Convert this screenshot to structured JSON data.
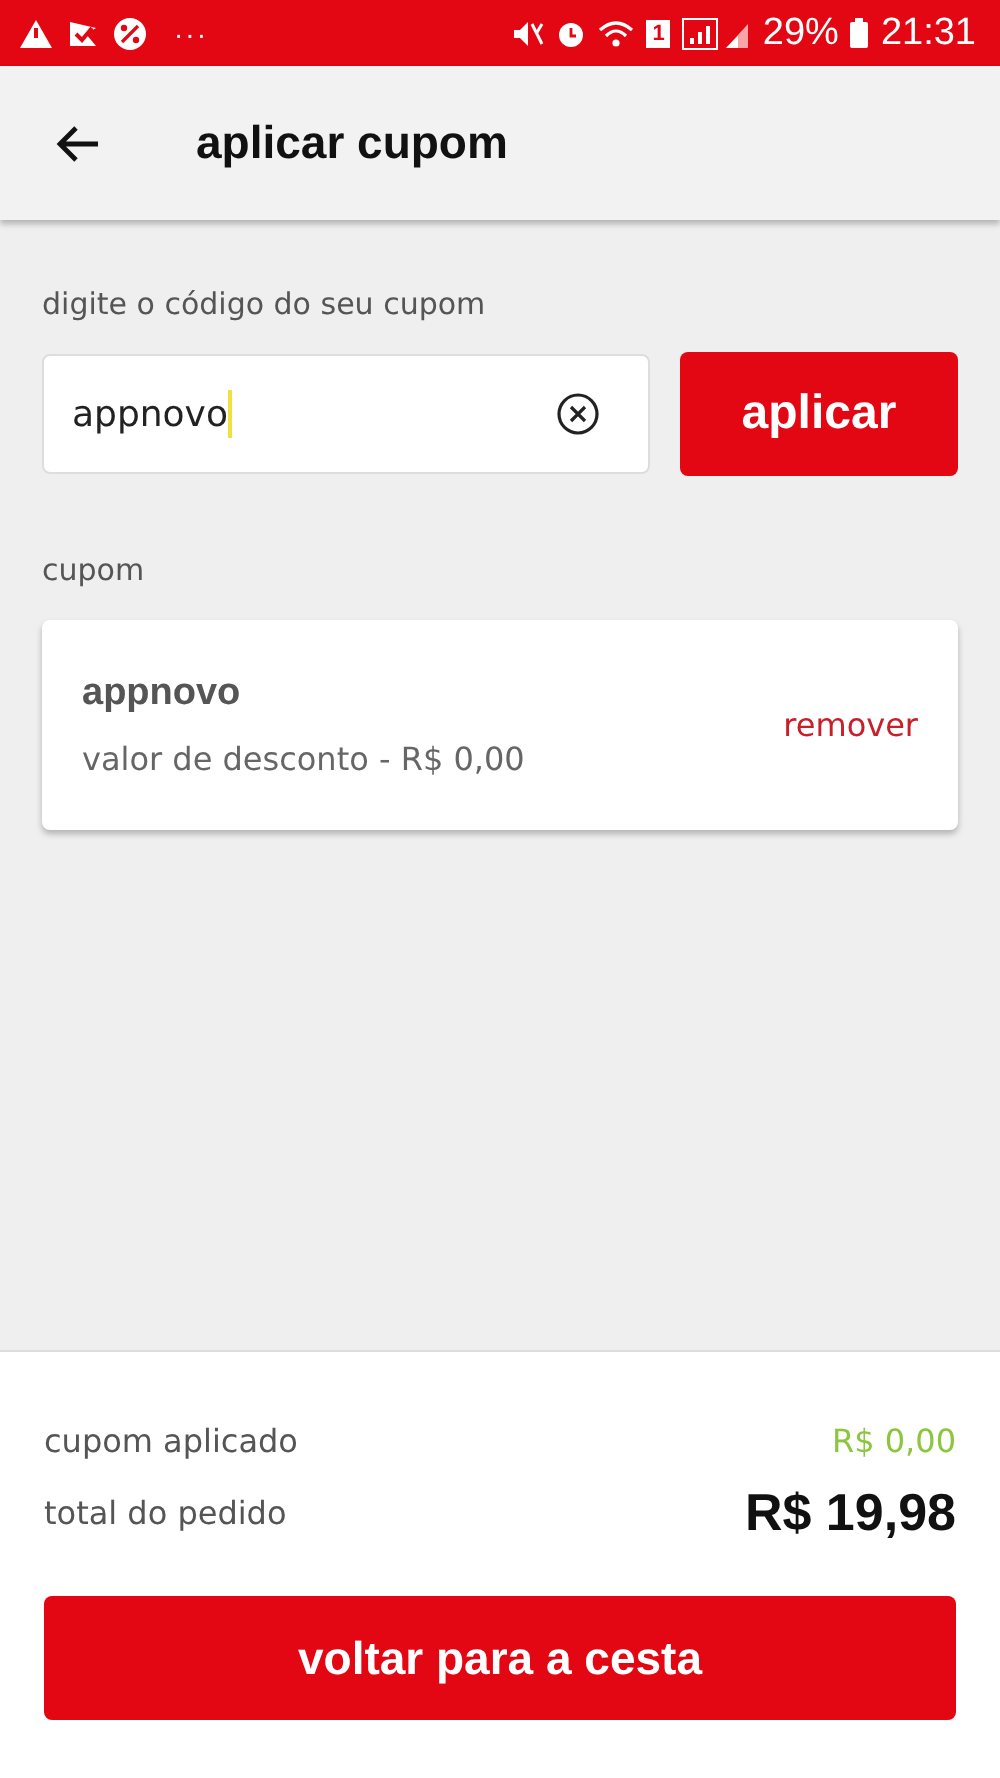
{
  "status_bar": {
    "more": "···",
    "sim": "1",
    "battery": "29%",
    "time": "21:31"
  },
  "header": {
    "title": "aplicar cupom"
  },
  "coupon_form": {
    "label": "digite o código do seu cupom",
    "field": {
      "value": "appnovo"
    },
    "button": "aplicar"
  },
  "section_label": "cupom",
  "coupons": [
    {
      "code": "appnovo",
      "detail": "valor de desconto - R$ 0,00",
      "action": "remover"
    }
  ],
  "summary": {
    "rows": [
      {
        "kind": "discount",
        "label": "cupom aplicado",
        "value": "R$ 0,00"
      },
      {
        "kind": "total",
        "label": "total do pedido",
        "value": "R$ 19,98"
      }
    ],
    "button": "voltar para a cesta"
  }
}
